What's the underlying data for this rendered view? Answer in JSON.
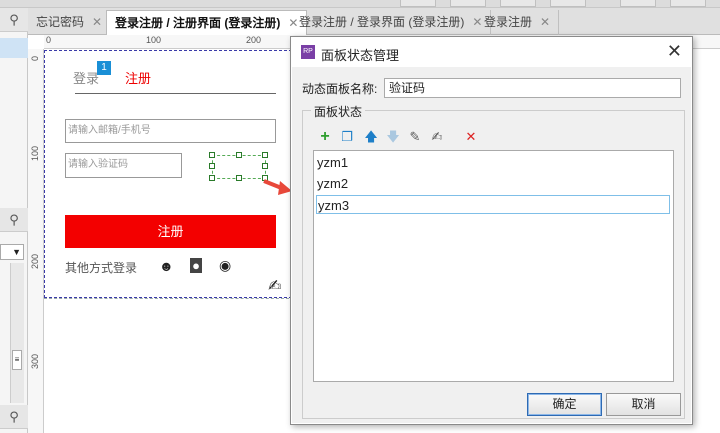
{
  "tabs": [
    {
      "label": "忘记密码"
    },
    {
      "label": "登录注册 / 注册界面 (登录注册)"
    },
    {
      "label": "登录注册 / 登录界面 (登录注册)"
    },
    {
      "label": "登录注册"
    }
  ],
  "ruler": {
    "top": [
      "0",
      "100",
      "200"
    ],
    "left": [
      "0",
      "100",
      "200",
      "300"
    ]
  },
  "canvas": {
    "tab_login": "登录",
    "tab_register": "注册",
    "tab_number": "1",
    "email_placeholder": "请输入邮箱/手机号",
    "code_placeholder": "请输入验证码",
    "register_button": "注册",
    "other_login": "其他方式登录"
  },
  "dialog": {
    "title": "面板状态管理",
    "icon_text": "RP",
    "close": "✕",
    "panel_name_label": "动态面板名称:",
    "panel_name_value": "验证码",
    "states_group": "面板状态",
    "states": [
      "yzm1",
      "yzm2",
      "yzm3"
    ],
    "ok": "确定",
    "cancel": "取消"
  },
  "colors": {
    "accent_red": "#f30000",
    "selection_blue": "#7fbfe8"
  }
}
